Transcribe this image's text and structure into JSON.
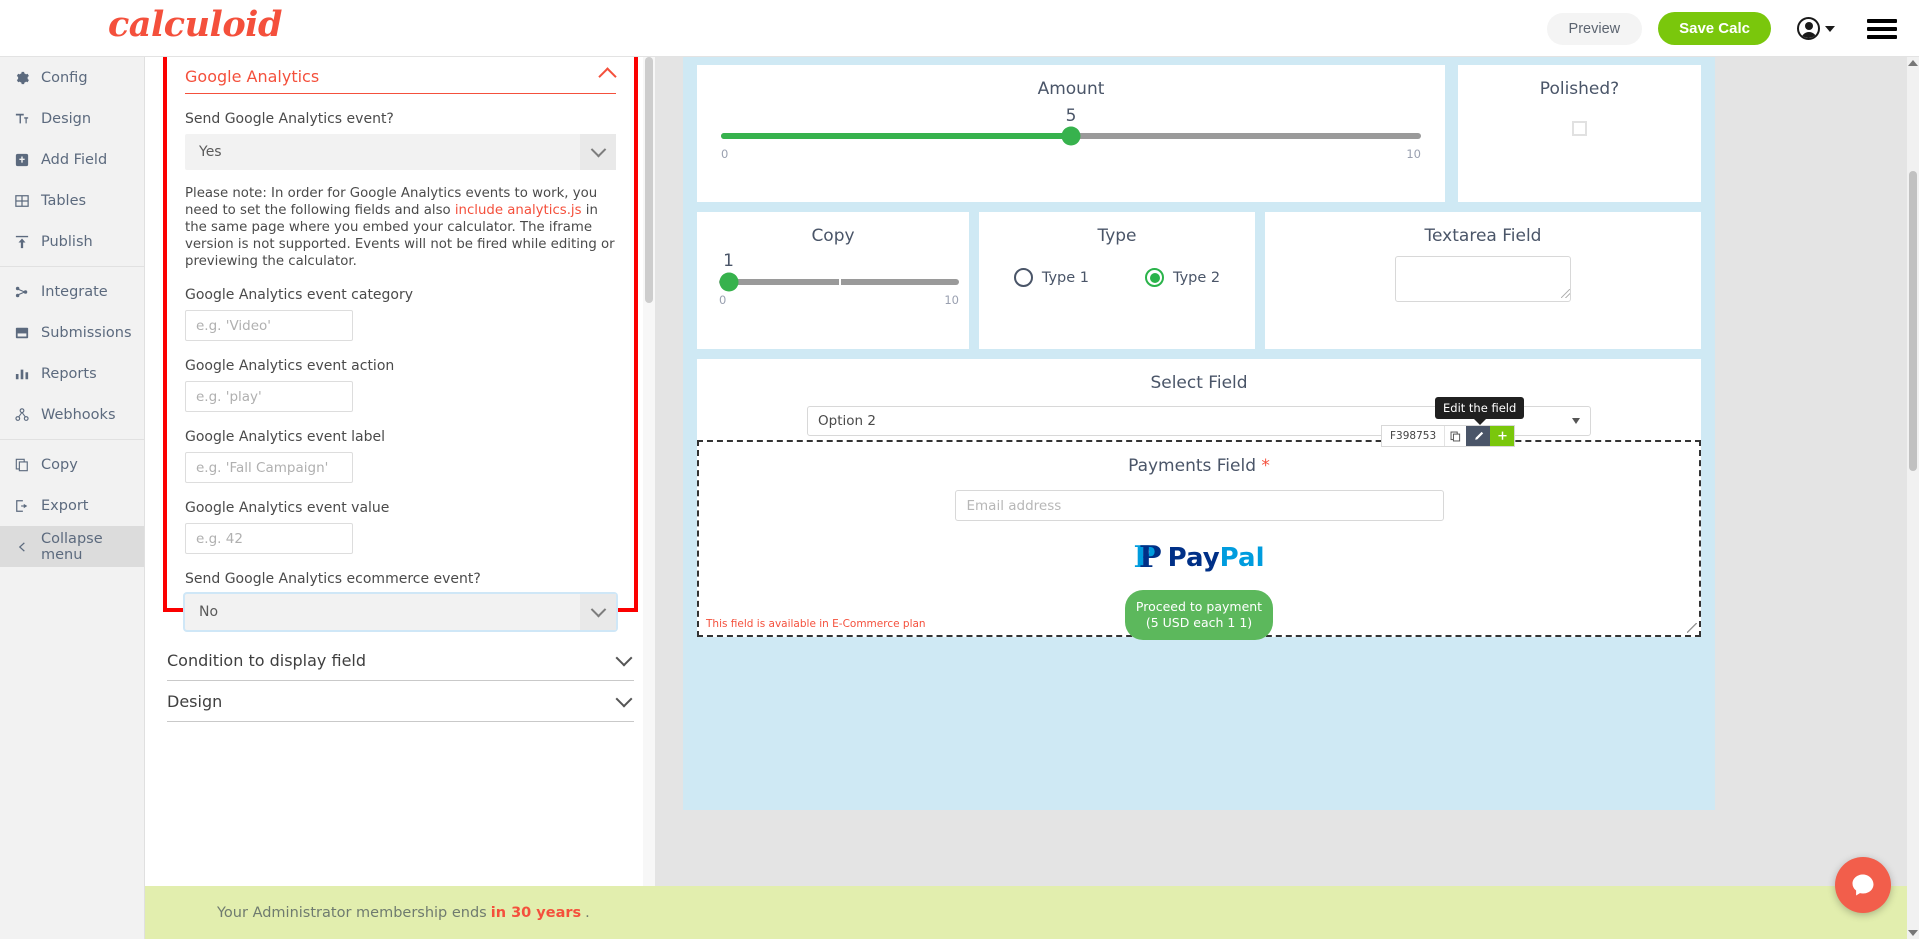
{
  "brand": {
    "logo_text": "calculoid",
    "logo_color": "#f4503c"
  },
  "header": {
    "preview_label": "Preview",
    "save_label": "Save Calc"
  },
  "sidebar": {
    "items": [
      {
        "label": "Config",
        "icon": "gear-icon"
      },
      {
        "label": "Design",
        "icon": "text-size-icon"
      },
      {
        "label": "Add Field",
        "icon": "plus-square-icon"
      },
      {
        "label": "Tables",
        "icon": "table-icon"
      },
      {
        "label": "Publish",
        "icon": "upload-icon"
      },
      {
        "label": "Integrate",
        "icon": "sitemap-icon"
      },
      {
        "label": "Submissions",
        "icon": "inbox-icon"
      },
      {
        "label": "Reports",
        "icon": "bar-chart-icon"
      },
      {
        "label": "Webhooks",
        "icon": "share-nodes-icon"
      },
      {
        "label": "Copy",
        "icon": "copy-icon"
      },
      {
        "label": "Export",
        "icon": "export-icon"
      }
    ],
    "collapse_label": "Collapse menu"
  },
  "config_panel": {
    "ga": {
      "title": "Google Analytics",
      "send_event_label": "Send Google Analytics event?",
      "send_event_value": "Yes",
      "note_prefix": "Please note: In order for Google Analytics events to work, you need to set the following fields and also ",
      "note_link": "include analytics.js",
      "note_suffix": " in the same page where you embed your calculator. The iframe version is not supported. Events will not be fired while editing or previewing the calculator.",
      "fields": [
        {
          "label": "Google Analytics event category",
          "placeholder": "e.g. 'Video'",
          "value": ""
        },
        {
          "label": "Google Analytics event action",
          "placeholder": "e.g. 'play'",
          "value": ""
        },
        {
          "label": "Google Analytics event label",
          "placeholder": "e.g. 'Fall Campaign'",
          "value": ""
        },
        {
          "label": "Google Analytics event value",
          "placeholder": "e.g. 42",
          "value": ""
        }
      ],
      "ecommerce_label": "Send Google Analytics ecommerce event?",
      "ecommerce_value": "No"
    },
    "accordions": [
      {
        "label": "Condition to display field"
      },
      {
        "label": "Design"
      }
    ]
  },
  "calculator": {
    "amount": {
      "title": "Amount",
      "value": "5",
      "min": "0",
      "max": "10",
      "percent": 50
    },
    "polished": {
      "title": "Polished?",
      "checked": false
    },
    "copy": {
      "title": "Copy",
      "value": "1",
      "min": "0",
      "max": "10",
      "percent": 4
    },
    "type": {
      "title": "Type",
      "options": [
        {
          "label": "Type 1",
          "selected": false
        },
        {
          "label": "Type 2",
          "selected": true
        }
      ]
    },
    "textarea": {
      "title": "Textarea Field",
      "value": ""
    },
    "select": {
      "title": "Select Field",
      "value": "Option 2"
    },
    "field_toolbar": {
      "field_id": "F398753",
      "tooltip": "Edit the field",
      "copy_icon": "copy-icon",
      "edit_icon": "pencil-icon",
      "add_icon": "plus-icon"
    },
    "payments": {
      "title": "Payments Field",
      "required_mark": "*",
      "email_placeholder": "Email address",
      "email_value": "",
      "paypal_label_a": "Pay",
      "paypal_label_b": "Pal",
      "proceed_line1": "Proceed to payment",
      "proceed_line2": "(5 USD each 1 1)",
      "ecommerce_note": "This field is available in E-Commerce plan"
    }
  },
  "footer": {
    "text_prefix": "Your Administrator membership ends ",
    "text_highlight": "in 30 years",
    "text_suffix": "."
  },
  "colors": {
    "accent": "#f4503c",
    "green": "#7ac70c",
    "slider_green": "#37b24d",
    "canvas_blue": "#cfe9f4",
    "banner_green": "#e2eeae"
  }
}
